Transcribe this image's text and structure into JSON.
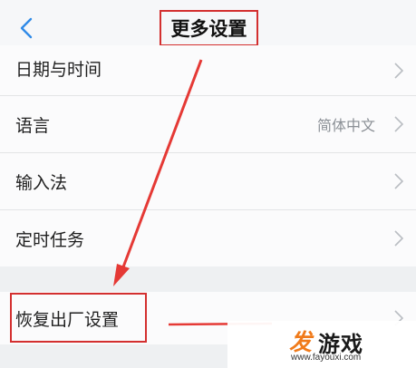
{
  "header": {
    "title": "更多设置",
    "back_icon": "chevron-left-icon"
  },
  "settings_group_1": [
    {
      "label": "日期与时间",
      "value": ""
    },
    {
      "label": "语言",
      "value": "简体中文"
    },
    {
      "label": "输入法",
      "value": ""
    },
    {
      "label": "定时任务",
      "value": ""
    }
  ],
  "settings_group_2": [
    {
      "label": "恢复出厂设置",
      "value": ""
    }
  ],
  "watermark": {
    "mark": "发",
    "name": "游戏",
    "url": "www.fayouxi.com"
  },
  "colors": {
    "accent": "#2f8ae8",
    "annotation": "#d32f2f",
    "watermark_orange": "#f07a1a"
  }
}
